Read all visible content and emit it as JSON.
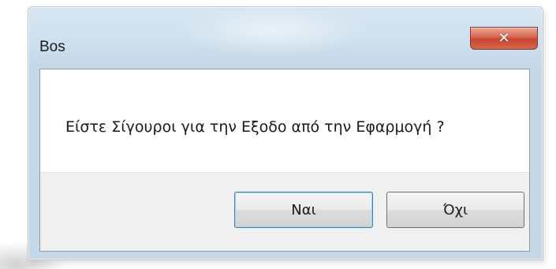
{
  "window": {
    "title": "Bos",
    "close_icon": "close-icon",
    "close_glyph": "✕",
    "close_color": "#c74330"
  },
  "dialog": {
    "message": "Είστε Σίγουροι για την Εξοδο από την Εφαρμογή ?"
  },
  "buttons": {
    "yes_label": "Ναι",
    "no_label": "Όχι"
  }
}
